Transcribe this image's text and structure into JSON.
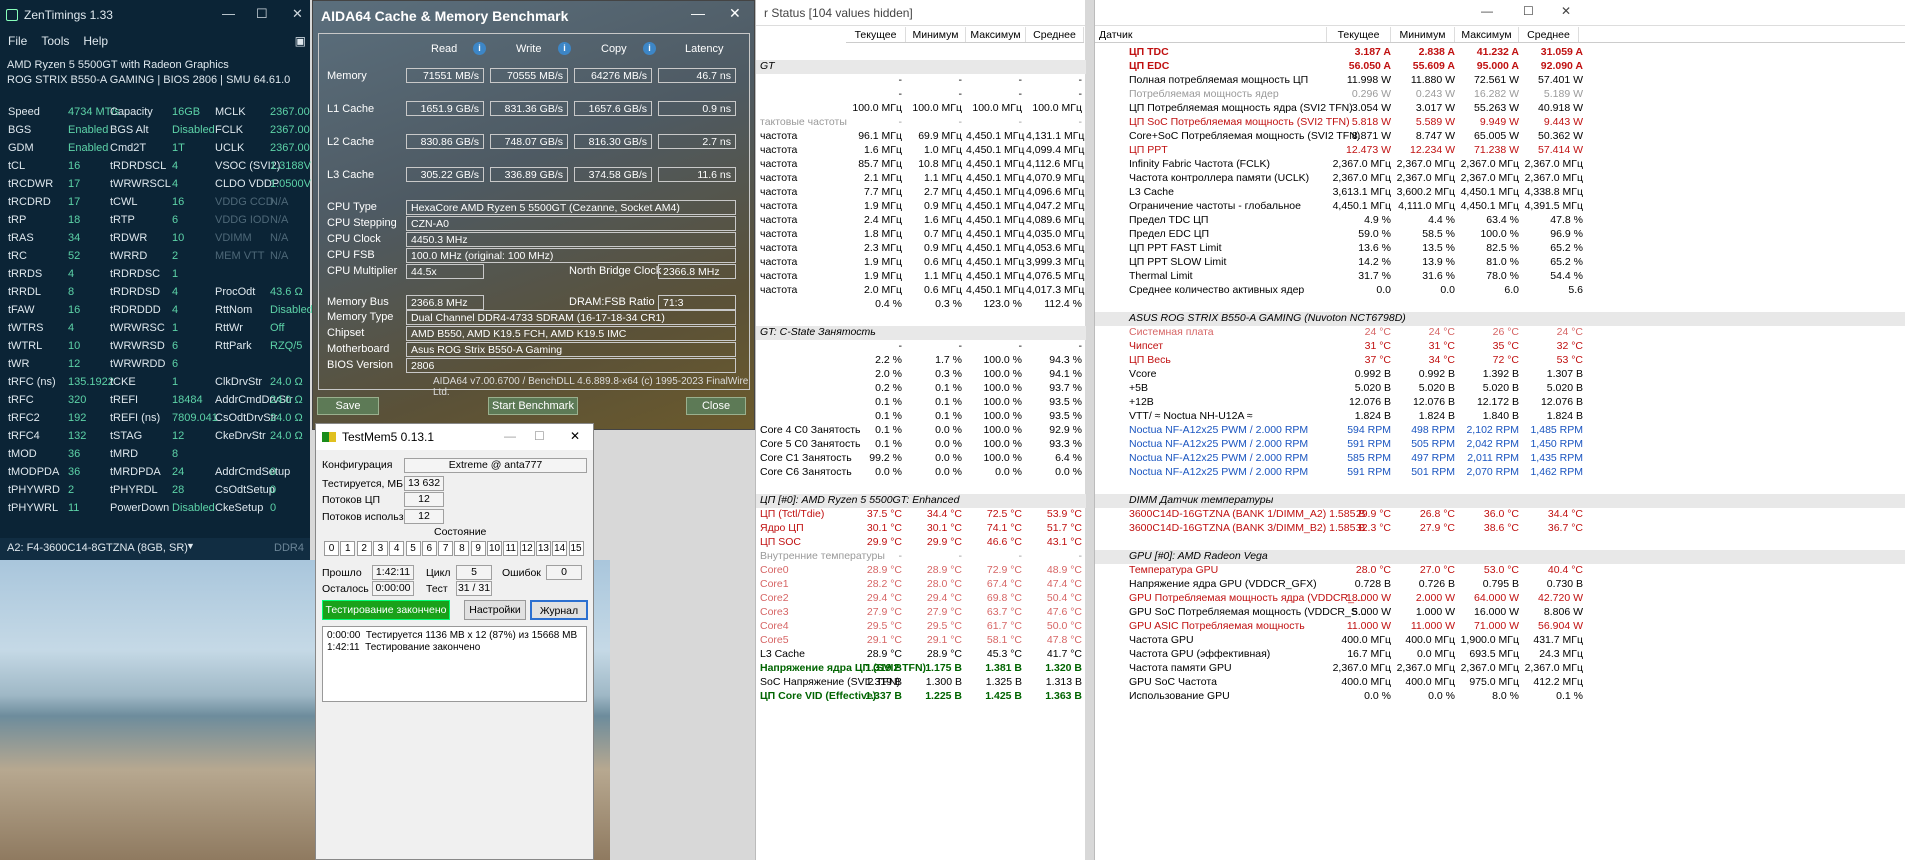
{
  "zen": {
    "title": "ZenTimings 1.33",
    "menu": [
      "File",
      "Tools",
      "Help"
    ],
    "cpu": "AMD Ryzen 5 5500GT with Radeon Graphics",
    "board": "ROG STRIX B550-A GAMING | BIOS 2806 | SMU 64.61.0",
    "rows": [
      [
        "Speed",
        "4734 MT/s",
        "Capacity",
        "16GB",
        "MCLK",
        "2367.00",
        0
      ],
      [
        "BGS",
        "Enabled",
        "BGS Alt",
        "Disabled",
        "FCLK",
        "2367.00",
        0
      ],
      [
        "GDM",
        "Enabled",
        "Cmd2T",
        "1T",
        "UCLK",
        "2367.00",
        0
      ],
      [
        "tCL",
        "16",
        "tRDRDSCL",
        "4",
        "VSOC (SVI2)",
        "1.3188V",
        0
      ],
      [
        "tRCDWR",
        "17",
        "tWRWRSCL",
        "4",
        "CLDO VDDP",
        "1.0500V",
        0
      ],
      [
        "tRCDRD",
        "17",
        "tCWL",
        "16",
        "VDDG CCD",
        "N/A",
        1
      ],
      [
        "tRP",
        "18",
        "tRTP",
        "6",
        "VDDG IOD",
        "N/A",
        1
      ],
      [
        "tRAS",
        "34",
        "tRDWR",
        "10",
        "VDIMM",
        "N/A",
        1
      ],
      [
        "tRC",
        "52",
        "tWRRD",
        "2",
        "MEM VTT",
        "N/A",
        1
      ],
      [
        "tRRDS",
        "4",
        "tRDRDSC",
        "1",
        "",
        "",
        0
      ],
      [
        "tRRDL",
        "8",
        "tRDRDSD",
        "4",
        "ProcOdt",
        "43.6 Ω",
        0
      ],
      [
        "tFAW",
        "16",
        "tRDRDDD",
        "4",
        "RttNom",
        "Disabled",
        0
      ],
      [
        "tWTRS",
        "4",
        "tWRWRSC",
        "1",
        "RttWr",
        "Off",
        0
      ],
      [
        "tWTRL",
        "10",
        "tWRWRSD",
        "6",
        "RttPark",
        "RZQ/5",
        0
      ],
      [
        "tWR",
        "12",
        "tWRWRDD",
        "6",
        "",
        "",
        0
      ],
      [
        "tRFC (ns)",
        "135.1922",
        "tCKE",
        "1",
        "ClkDrvStr",
        "24.0 Ω",
        0
      ],
      [
        "tRFC",
        "320",
        "tREFI",
        "18484",
        "AddrCmdDrvStr",
        "24.0 Ω",
        0
      ],
      [
        "tRFC2",
        "192",
        "tREFI (ns)",
        "7809.041",
        "CsOdtDrvStr",
        "24.0 Ω",
        0
      ],
      [
        "tRFC4",
        "132",
        "tSTAG",
        "12",
        "CkeDrvStr",
        "24.0 Ω",
        0
      ],
      [
        "tMOD",
        "36",
        "tMRD",
        "8",
        "",
        "",
        0
      ],
      [
        "tMODPDA",
        "36",
        "tMRDPDA",
        "24",
        "AddrCmdSetup",
        "0",
        0
      ],
      [
        "tPHYWRD",
        "2",
        "tPHYRDL",
        "28",
        "CsOdtSetup",
        "0",
        0
      ],
      [
        "tPHYWRL",
        "11",
        "PowerDown",
        "Disabled",
        "CkeSetup",
        "0",
        0
      ]
    ],
    "footer": "A2: F4-3600C14-8GTZNA (8GB, SR)",
    "footer_right": "DDR4"
  },
  "aida": {
    "title": "AIDA64 Cache & Memory Benchmark",
    "headers": [
      "Read",
      "Write",
      "Copy",
      "Latency"
    ],
    "bench": [
      [
        "Memory",
        "71551 MB/s",
        "70555 MB/s",
        "64276 MB/s",
        "46.7 ns"
      ],
      [
        "L1 Cache",
        "1651.9 GB/s",
        "831.36 GB/s",
        "1657.6 GB/s",
        "0.9 ns"
      ],
      [
        "L2 Cache",
        "830.86 GB/s",
        "748.07 GB/s",
        "816.30 GB/s",
        "2.7 ns"
      ],
      [
        "L3 Cache",
        "305.22 GB/s",
        "336.89 GB/s",
        "374.58 GB/s",
        "11.6 ns"
      ]
    ],
    "cpu_type": [
      "CPU Type",
      "HexaCore AMD Ryzen 5 5500GT  (Cezanne, Socket AM4)"
    ],
    "cpu_stepping": [
      "CPU Stepping",
      "CZN-A0"
    ],
    "cpu_clock": [
      "CPU Clock",
      "4450.3 MHz"
    ],
    "cpu_fsb": [
      "CPU FSB",
      "100.0 MHz  (original: 100 MHz)"
    ],
    "cpu_mult": [
      "CPU Multiplier",
      "44.5x"
    ],
    "nb_label": "North Bridge Clock",
    "nb_value": "2366.8 MHz",
    "mem_bus": [
      "Memory Bus",
      "2366.8 MHz"
    ],
    "ratio_label": "DRAM:FSB Ratio",
    "ratio_value": "71:3",
    "mem_type": [
      "Memory Type",
      "Dual Channel DDR4-4733 SDRAM  (16-17-18-34 CR1)"
    ],
    "chipset": [
      "Chipset",
      "AMD B550, AMD K19.5 FCH, AMD K19.5 IMC"
    ],
    "mobo": [
      "Motherboard",
      "Asus ROG Strix B550-A Gaming"
    ],
    "bios": [
      "BIOS Version",
      "2806"
    ],
    "footer": "AIDA64 v7.00.6700 / BenchDLL 4.6.889.8-x64  (c) 1995-2023 FinalWire Ltd.",
    "save": "Save",
    "start": "Start Benchmark",
    "close": "Close"
  },
  "tm": {
    "title": "TestMem5  0.13.1",
    "config_label": "Конфигурация",
    "config": "Extreme @ anta777",
    "tested_label": "Тестируется, МБ",
    "tested": "13 632",
    "threads_label": "Потоков ЦП",
    "threads": "12",
    "used_label": "Потоков использ.",
    "used": "12",
    "state_label": "Состояние",
    "cells": [
      "0",
      "1",
      "2",
      "3",
      "4",
      "5",
      "6",
      "7",
      "8",
      "9",
      "10",
      "11",
      "12",
      "13",
      "14",
      "15"
    ],
    "passed_label": "Прошло",
    "passed": "1:42:11",
    "cycle_label": "Цикл",
    "cycle": "5",
    "errors_label": "Ошибок",
    "errors": "0",
    "left_label": "Осталось",
    "left": "0:00:00",
    "test_label": "Тест",
    "test": "31 / 31",
    "done": "Тестирование закончено",
    "settings": "Настройки",
    "journal": "Журнал",
    "log": "0:00:00  Тестируется 1136 MB x 12 (87%) из 15668 MB\n1:42:11  Тестирование закончено"
  },
  "hw1": {
    "title": "r Status [104 values hidden]",
    "cols": [
      "Текущее",
      "Минимум",
      "Максимум",
      "Среднее"
    ],
    "rows": [
      [
        "",
        "",
        "",
        "",
        "",
        "blank"
      ],
      [
        "GT",
        "",
        "",
        "",
        "",
        "grp"
      ],
      [
        "",
        "-",
        "-",
        "-",
        "-",
        ""
      ],
      [
        "",
        "-",
        "-",
        "-",
        "-",
        ""
      ],
      [
        "",
        "100.0 МГц",
        "100.0 МГц",
        "100.0 МГц",
        "100.0 МГц",
        ""
      ],
      [
        "тактовые частоты",
        "-",
        "-",
        "-",
        "-",
        "gray"
      ],
      [
        "частота",
        "96.1 МГц",
        "69.9 МГц",
        "4,450.1 МГц",
        "4,131.1 МГц",
        ""
      ],
      [
        "частота",
        "1.6 МГц",
        "1.0 МГц",
        "4,450.1 МГц",
        "4,099.4 МГц",
        ""
      ],
      [
        "частота",
        "85.7 МГц",
        "10.8 МГц",
        "4,450.1 МГц",
        "4,112.6 МГц",
        ""
      ],
      [
        "частота",
        "2.1 МГц",
        "1.1 МГц",
        "4,450.1 МГц",
        "4,070.9 МГц",
        ""
      ],
      [
        "частота",
        "7.7 МГц",
        "2.7 МГц",
        "4,450.1 МГц",
        "4,096.6 МГц",
        ""
      ],
      [
        "частота",
        "1.9 МГц",
        "0.9 МГц",
        "4,450.1 МГц",
        "4,047.2 МГц",
        ""
      ],
      [
        "частота",
        "2.4 МГц",
        "1.6 МГц",
        "4,450.1 МГц",
        "4,089.6 МГц",
        ""
      ],
      [
        "частота",
        "1.8 МГц",
        "0.7 МГц",
        "4,450.1 МГц",
        "4,035.0 МГц",
        ""
      ],
      [
        "частота",
        "2.3 МГц",
        "0.9 МГц",
        "4,450.1 МГц",
        "4,053.6 МГц",
        ""
      ],
      [
        "частота",
        "1.9 МГц",
        "0.6 МГц",
        "4,450.1 МГц",
        "3,999.3 МГц",
        ""
      ],
      [
        "частота",
        "1.9 МГц",
        "1.1 МГц",
        "4,450.1 МГц",
        "4,076.5 МГц",
        ""
      ],
      [
        "частота",
        "2.0 МГц",
        "0.6 МГц",
        "4,450.1 МГц",
        "4,017.3 МГц",
        ""
      ],
      [
        "",
        "0.4 %",
        "0.3 %",
        "123.0 %",
        "112.4 %",
        ""
      ],
      [
        "",
        "",
        "",
        "",
        "",
        "blank"
      ],
      [
        "GT: C-State Занятость",
        "",
        "",
        "",
        "",
        "grp"
      ],
      [
        "",
        "-",
        "-",
        "-",
        "-",
        ""
      ],
      [
        "",
        "2.2 %",
        "1.7 %",
        "100.0 %",
        "94.3 %",
        ""
      ],
      [
        "",
        "2.0 %",
        "0.3 %",
        "100.0 %",
        "94.1 %",
        ""
      ],
      [
        "",
        "0.2 %",
        "0.1 %",
        "100.0 %",
        "93.7 %",
        ""
      ],
      [
        "",
        "0.1 %",
        "0.1 %",
        "100.0 %",
        "93.5 %",
        ""
      ],
      [
        "",
        "0.1 %",
        "0.1 %",
        "100.0 %",
        "93.5 %",
        ""
      ],
      [
        "Core 4 C0 Занятость",
        "0.1 %",
        "0.0 %",
        "100.0 %",
        "92.9 %",
        ""
      ],
      [
        "Core 5 C0 Занятость",
        "0.1 %",
        "0.0 %",
        "100.0 %",
        "93.3 %",
        ""
      ],
      [
        "Core C1 Занятость",
        "99.2 %",
        "0.0 %",
        "100.0 %",
        "6.4 %",
        ""
      ],
      [
        "Core C6 Занятость",
        "0.0 %",
        "0.0 %",
        "0.0 %",
        "0.0 %",
        ""
      ],
      [
        "",
        "",
        "",
        "",
        "",
        "blank"
      ],
      [
        "ЦП [#0]: AMD Ryzen 5 5500GT: Enhanced",
        "",
        "",
        "",
        "",
        "grp"
      ],
      [
        "ЦП (Tctl/Tdie)",
        "37.5 °C",
        "34.4 °C",
        "72.5 °C",
        "53.9 °C",
        "red"
      ],
      [
        "Ядро ЦП",
        "30.1 °C",
        "30.1 °C",
        "74.1 °C",
        "51.7 °C",
        "red"
      ],
      [
        "ЦП SOC",
        "29.9 °C",
        "29.9 °C",
        "46.6 °C",
        "43.1 °C",
        "red"
      ],
      [
        "Внутренние температуры",
        "-",
        "-",
        "-",
        "-",
        "gray"
      ],
      [
        "Core0",
        "28.9 °C",
        "28.9 °C",
        "72.9 °C",
        "48.9 °C",
        "lred"
      ],
      [
        "Core1",
        "28.2 °C",
        "28.0 °C",
        "67.4 °C",
        "47.4 °C",
        "lred"
      ],
      [
        "Core2",
        "29.4 °C",
        "29.4 °C",
        "69.8 °C",
        "50.4 °C",
        "lred"
      ],
      [
        "Core3",
        "27.9 °C",
        "27.9 °C",
        "63.7 °C",
        "47.6 °C",
        "lred"
      ],
      [
        "Core4",
        "29.5 °C",
        "29.5 °C",
        "61.7 °C",
        "50.0 °C",
        "lred"
      ],
      [
        "Core5",
        "29.1 °C",
        "29.1 °C",
        "58.1 °C",
        "47.8 °C",
        "lred"
      ],
      [
        "L3 Cache",
        "28.9 °C",
        "28.9 °C",
        "45.3 °C",
        "41.7 °C",
        ""
      ],
      [
        "Напряжение ядра ЦП (SVI2 TFN)",
        "1.319 В",
        "1.175 В",
        "1.381 В",
        "1.320 В",
        "grn"
      ],
      [
        "SoC Напряжение (SVI2 TFN)",
        "1.319 В",
        "1.300 В",
        "1.325 В",
        "1.313 В",
        ""
      ],
      [
        "ЦП Core VID (Effective)",
        "1.337 В",
        "1.225 В",
        "1.425 В",
        "1.363 В",
        "grn"
      ]
    ]
  },
  "hw2": {
    "sensor_label": "Датчик",
    "cols": [
      "Текущее",
      "Минимум",
      "Максимум",
      "Среднее"
    ],
    "rows": [
      [
        "ЦП TDC",
        "3.187 A",
        "2.838 A",
        "41.232 A",
        "31.059 A",
        "boldred"
      ],
      [
        "ЦП EDC",
        "56.050 A",
        "55.609 A",
        "95.000 A",
        "92.090 A",
        "boldred"
      ],
      [
        "Полная потребляемая мощность ЦП",
        "11.998 W",
        "11.880 W",
        "72.561 W",
        "57.401 W",
        ""
      ],
      [
        "Потребляемая мощность ядер",
        "0.296 W",
        "0.243 W",
        "16.282 W",
        "5.189 W",
        "gray"
      ],
      [
        "ЦП Потребляемая мощность ядра (SVI2 TFN)",
        "3.054 W",
        "3.017 W",
        "55.263 W",
        "40.918 W",
        ""
      ],
      [
        "ЦП SoC Потребляемая мощность (SVI2 TFN)",
        "5.818 W",
        "5.589 W",
        "9.949 W",
        "9.443 W",
        "red"
      ],
      [
        "Core+SoC Потребляемая мощность (SVI2 TFN)",
        "8.871 W",
        "8.747 W",
        "65.005 W",
        "50.362 W",
        ""
      ],
      [
        "ЦП PPT",
        "12.473 W",
        "12.234 W",
        "71.238 W",
        "57.414 W",
        "red"
      ],
      [
        "Infinity Fabric Частота (FCLK)",
        "2,367.0 МГц",
        "2,367.0 МГц",
        "2,367.0 МГц",
        "2,367.0 МГц",
        ""
      ],
      [
        "Частота контроллера памяти (UCLK)",
        "2,367.0 МГц",
        "2,367.0 МГц",
        "2,367.0 МГц",
        "2,367.0 МГц",
        ""
      ],
      [
        "L3 Cache",
        "3,613.1 МГц",
        "3,600.2 МГц",
        "4,450.1 МГц",
        "4,338.8 МГц",
        ""
      ],
      [
        "Ограничение частоты - глобальное",
        "4,450.1 МГц",
        "4,111.0 МГц",
        "4,450.1 МГц",
        "4,391.5 МГц",
        ""
      ],
      [
        "Предел TDC ЦП",
        "4.9 %",
        "4.4 %",
        "63.4 %",
        "47.8 %",
        ""
      ],
      [
        "Предел EDC ЦП",
        "59.0 %",
        "58.5 %",
        "100.0 %",
        "96.9 %",
        ""
      ],
      [
        "ЦП PPT FAST Limit",
        "13.6 %",
        "13.5 %",
        "82.5 %",
        "65.2 %",
        ""
      ],
      [
        "ЦП PPT SLOW Limit",
        "14.2 %",
        "13.9 %",
        "81.0 %",
        "65.2 %",
        ""
      ],
      [
        "Thermal Limit",
        "31.7 %",
        "31.6 %",
        "78.0 %",
        "54.4 %",
        ""
      ],
      [
        "Среднее количество активных ядер",
        "0.0",
        "0.0",
        "6.0",
        "5.6",
        ""
      ],
      [
        "",
        "",
        "",
        "",
        "",
        "blank"
      ],
      [
        "ASUS ROG STRIX B550-A GAMING (Nuvoton NCT6798D)",
        "",
        "",
        "",
        "",
        "grp"
      ],
      [
        "Системная плата",
        "24 °C",
        "24 °C",
        "26 °C",
        "24 °C",
        "lred"
      ],
      [
        "Чипсет",
        "31 °C",
        "31 °C",
        "35 °C",
        "32 °C",
        "red"
      ],
      [
        "ЦП Весь",
        "37 °C",
        "34 °C",
        "72 °C",
        "53 °C",
        "red"
      ],
      [
        "Vcore",
        "0.992 В",
        "0.992 В",
        "1.392 В",
        "1.307 В",
        ""
      ],
      [
        "+5В",
        "5.020 В",
        "5.020 В",
        "5.020 В",
        "5.020 В",
        ""
      ],
      [
        "+12В",
        "12.076 В",
        "12.076 В",
        "12.172 В",
        "12.076 В",
        ""
      ],
      [
        "VTT/ ≈ Noctua NH-U12A ≈",
        "1.824 В",
        "1.824 В",
        "1.840 В",
        "1.824 В",
        ""
      ],
      [
        "Noctua NF-A12x25 PWM / 2.000 RPM",
        "594 RPM",
        "498 RPM",
        "2,102 RPM",
        "1,485 RPM",
        "blue"
      ],
      [
        "Noctua NF-A12x25 PWM / 2.000 RPM",
        "591 RPM",
        "505 RPM",
        "2,042 RPM",
        "1,450 RPM",
        "blue"
      ],
      [
        "Noctua NF-A12x25 PWM / 2.000 RPM",
        "585 RPM",
        "497 RPM",
        "2,011 RPM",
        "1,435 RPM",
        "blue"
      ],
      [
        "Noctua NF-A12x25 PWM / 2.000 RPM",
        "591 RPM",
        "501 RPM",
        "2,070 RPM",
        "1,462 RPM",
        "blue"
      ],
      [
        "",
        "",
        "",
        "",
        "",
        "blank"
      ],
      [
        "DIMM Датчик температуры",
        "",
        "",
        "",
        "",
        "grp"
      ],
      [
        "3600C14D-16GTZNA (BANK 1/DIMM_A2) 1.585 В",
        "29.9 °C",
        "26.8 °C",
        "36.0 °C",
        "34.4 °C",
        "red"
      ],
      [
        "3600C14D-16GTZNA (BANK 3/DIMM_B2) 1.585 В",
        "32.3 °C",
        "27.9 °C",
        "38.6 °C",
        "36.7 °C",
        "red"
      ],
      [
        "",
        "",
        "",
        "",
        "",
        "blank"
      ],
      [
        "GPU [#0]: AMD Radeon Vega",
        "",
        "",
        "",
        "",
        "grp"
      ],
      [
        "Температура GPU",
        "28.0 °C",
        "27.0 °C",
        "53.0 °C",
        "40.4 °C",
        "red"
      ],
      [
        "Напряжение ядра GPU (VDDCR_GFX)",
        "0.728 В",
        "0.726 В",
        "0.795 В",
        "0.730 В",
        ""
      ],
      [
        "GPU Потребляемая мощность ядра (VDDCR_...",
        "18.000 W",
        "2.000 W",
        "64.000 W",
        "42.720 W",
        "red"
      ],
      [
        "GPU SoC Потребляемая мощность (VDDCR_S...",
        "5.000 W",
        "1.000 W",
        "16.000 W",
        "8.806 W",
        ""
      ],
      [
        "GPU ASIC Потребляемая мощность",
        "11.000 W",
        "11.000 W",
        "71.000 W",
        "56.904 W",
        "red"
      ],
      [
        "Частота GPU",
        "400.0 МГц",
        "400.0 МГц",
        "1,900.0 МГц",
        "431.7 МГц",
        ""
      ],
      [
        "Частота GPU (эффективная)",
        "16.7 МГц",
        "0.0 МГц",
        "693.5 МГц",
        "24.3 МГц",
        ""
      ],
      [
        "Частота памяти GPU",
        "2,367.0 МГц",
        "2,367.0 МГц",
        "2,367.0 МГц",
        "2,367.0 МГц",
        ""
      ],
      [
        "GPU SoC Частота",
        "400.0 МГц",
        "400.0 МГц",
        "975.0 МГц",
        "412.2 МГц",
        ""
      ],
      [
        "Использование GPU",
        "0.0 %",
        "0.0 %",
        "8.0 %",
        "0.1 %",
        ""
      ]
    ]
  }
}
